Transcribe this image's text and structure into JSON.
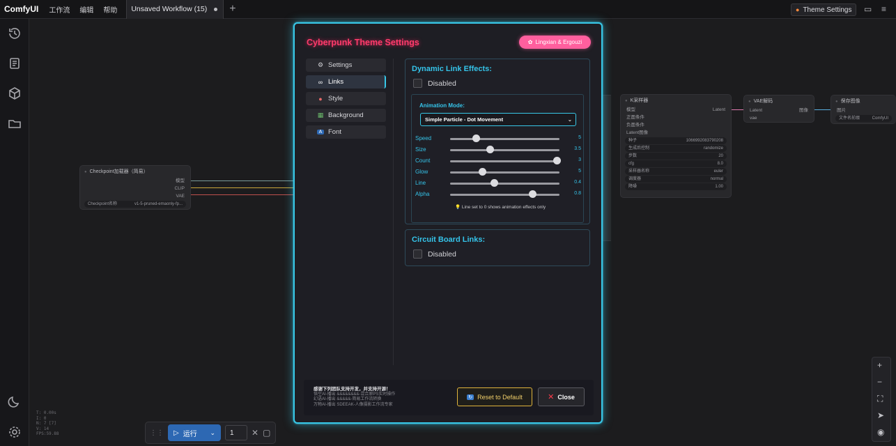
{
  "topbar": {
    "app_title": "ComfyUI",
    "menu": [
      "工作流",
      "编辑",
      "帮助"
    ],
    "workflow_tab": "Unsaved Workflow (15)",
    "theme_button": "Theme Settings"
  },
  "canvas": {
    "checkpoint_node": {
      "title": "Checkpoint加载器（简易）",
      "outputs": [
        "模型",
        "CLIP",
        "VAE"
      ],
      "field_label": "Checkpoint名称",
      "field_value": "v1-5-pruned-emaonly-fp..."
    },
    "ksampler_node": {
      "title": "K采样器",
      "inputs": [
        "模型",
        "正面条件",
        "负面条件",
        "Latent图像"
      ],
      "output": "Latent",
      "fields": [
        {
          "label": "种子",
          "value": "1066992083790208"
        },
        {
          "label": "生成后控制",
          "value": "randomize"
        },
        {
          "label": "步数",
          "value": "20"
        },
        {
          "label": "cfg",
          "value": "8.0"
        },
        {
          "label": "采样器名称",
          "value": "euler"
        },
        {
          "label": "调度器",
          "value": "normal"
        },
        {
          "label": "降噪",
          "value": "1.00"
        }
      ]
    },
    "vae_node": {
      "title": "VAE解码",
      "inputs": [
        "Latent",
        "vae"
      ],
      "output": "图像"
    },
    "save_node": {
      "title": "保存图像",
      "input": "图片",
      "field_label": "文件名前缀",
      "field_value": "ComfyUI"
    },
    "stats": [
      "T: 0.00s",
      "I: 0",
      "N: 7 [7]",
      "V: 14",
      "FPS:59.88"
    ],
    "run_button": "运行",
    "run_count": "1"
  },
  "modal": {
    "title": "Cyberpunk Theme Settings",
    "author_badge": "Lingxian & Ergouzi",
    "nav": [
      {
        "label": "Settings",
        "icon": "gear-icon",
        "glyph": "⚙"
      },
      {
        "label": "Links",
        "icon": "link-icon",
        "glyph": "🔗"
      },
      {
        "label": "Style",
        "icon": "palette-icon",
        "glyph": "🎨"
      },
      {
        "label": "Background",
        "icon": "image-icon",
        "glyph": "▦"
      },
      {
        "label": "Font",
        "icon": "font-icon",
        "glyph": "A"
      }
    ],
    "active_nav": "Links",
    "dynamic": {
      "title": "Dynamic Link Effects:",
      "checkbox_label": "Disabled",
      "checked": false,
      "animation_mode_label": "Animation Mode:",
      "animation_mode_value": "Simple Particle - Dot Movement",
      "sliders": [
        {
          "name": "Speed",
          "value": "5",
          "fraction": 0.24
        },
        {
          "name": "Size",
          "value": "3.5",
          "fraction": 0.37
        },
        {
          "name": "Count",
          "value": "3",
          "fraction": 1.0
        },
        {
          "name": "Glow",
          "value": "5",
          "fraction": 0.3
        },
        {
          "name": "Line",
          "value": "0.4",
          "fraction": 0.41
        },
        {
          "name": "Alpha",
          "value": "0.8",
          "fraction": 0.77
        }
      ],
      "hint": "Line set to 0 shows animation effects only"
    },
    "circuit": {
      "title": "Circuit Board Links:",
      "checkbox_label": "Disabled",
      "checked": false
    },
    "footer": {
      "credit_title": "感谢下列团队支持开发，并支持开源！",
      "credit_lines": [
        "悟空AI-播出 &&&&&&&&-混合原PS实时操作",
        "幻语AI-播出 &&&&&-简易工作流转换",
        "万物AI-播出 SDEEAK-人像摄影工作流专家"
      ],
      "reset_label": "Reset to Default",
      "close_label": "Close"
    }
  },
  "colors": {
    "accent_cyan": "#38c8e8",
    "title_pink": "#ff3b6b",
    "badge_pink": "#ff5f9e",
    "reset_gold": "#e0b43c",
    "run_blue": "#2d68b3"
  }
}
